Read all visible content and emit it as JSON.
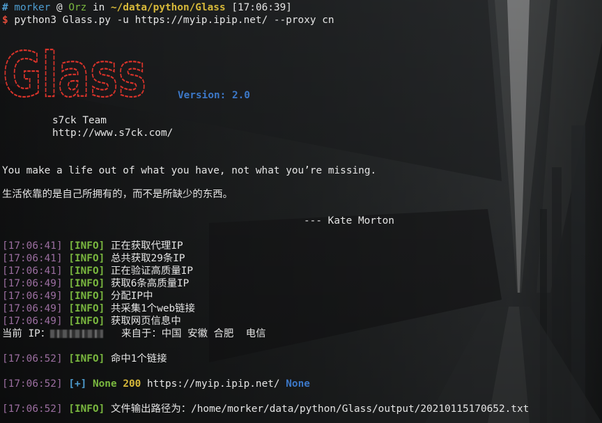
{
  "prompt": {
    "hash": "#",
    "user": "morker",
    "at": "@",
    "host": "Orz",
    "in": "in",
    "path": "~/data/python/Glass",
    "time": "[17:06:39]"
  },
  "command": {
    "dollar": "$",
    "text": "python3 Glass.py -u https://myip.ipip.net/ --proxy cn"
  },
  "banner": {
    "logo_text": "Glass",
    "version": "Version: 2.0",
    "team": "s7ck Team",
    "site": "http://www.s7ck.com/"
  },
  "quote": {
    "english": "You make a life out of what you have, not what you’re missing.",
    "chinese": "生活依靠的是自己所拥有的，而不是所缺少的东西。",
    "author": "--- Kate Morton"
  },
  "logs": [
    {
      "time": "[17:06:41]",
      "tag": "[INFO]",
      "msg": "正在获取代理IP"
    },
    {
      "time": "[17:06:41]",
      "tag": "[INFO]",
      "msg": "总共获取29条IP"
    },
    {
      "time": "[17:06:41]",
      "tag": "[INFO]",
      "msg": "正在验证高质量IP"
    },
    {
      "time": "[17:06:49]",
      "tag": "[INFO]",
      "msg": "获取6条高质量IP"
    },
    {
      "time": "[17:06:49]",
      "tag": "[INFO]",
      "msg": "分配IP中"
    },
    {
      "time": "[17:06:49]",
      "tag": "[INFO]",
      "msg": "共采集1个web链接"
    },
    {
      "time": "[17:06:49]",
      "tag": "[INFO]",
      "msg": "获取网页信息中"
    }
  ],
  "current_ip": {
    "label": "当前 IP：",
    "source": "来自于：中国 安徽 合肥  电信"
  },
  "hit": {
    "time": "[17:06:52]",
    "tag": "[INFO]",
    "msg": "命中1个链接"
  },
  "result": {
    "time": "[17:06:52]",
    "tag": "[+]",
    "none1": "None",
    "status": "200",
    "url": "https://myip.ipip.net/",
    "none2": "None"
  },
  "output": {
    "time": "[17:06:52]",
    "tag": "[INFO]",
    "msg": "文件输出路径为：/home/morker/data/python/Glass/output/20210115170652.txt"
  },
  "colors": {
    "cyan": "#4d9ccf",
    "green": "#7ab83f",
    "yellow": "#d6b83a",
    "red": "#e34b3a",
    "purple": "#9b6ea0",
    "blue": "#3c78c8"
  }
}
